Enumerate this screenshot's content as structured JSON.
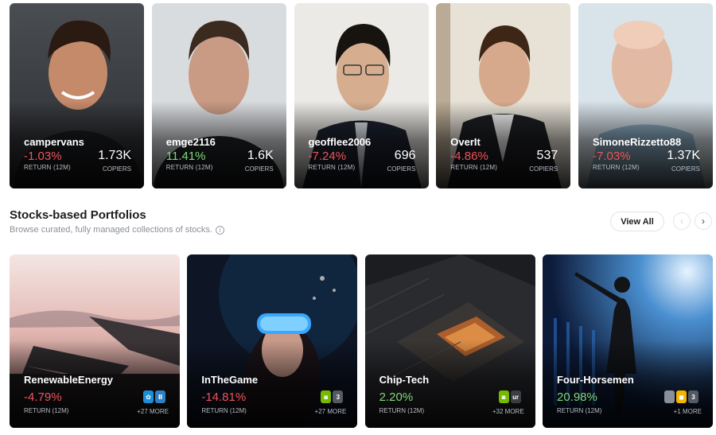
{
  "traders": [
    {
      "username": "campervans",
      "return": "-1.03%",
      "return_label": "RETURN (12M)",
      "copiers": "1.73K",
      "copiers_label": "COPIERS",
      "sentiment": "negative"
    },
    {
      "username": "emge2116",
      "return": "11.41%",
      "return_label": "RETURN (12M)",
      "copiers": "1.6K",
      "copiers_label": "COPIERS",
      "sentiment": "positive"
    },
    {
      "username": "geofflee2006",
      "return": "-7.24%",
      "return_label": "RETURN (12M)",
      "copiers": "696",
      "copiers_label": "COPIERS",
      "sentiment": "negative"
    },
    {
      "username": "OverIt",
      "return": "-4.86%",
      "return_label": "RETURN (12M)",
      "copiers": "537",
      "copiers_label": "COPIERS",
      "sentiment": "negative"
    },
    {
      "username": "SimoneRizzetto88",
      "return": "-7.03%",
      "return_label": "RETURN (12M)",
      "copiers": "1.37K",
      "copiers_label": "COPIERS",
      "sentiment": "negative"
    }
  ],
  "section": {
    "title": "Stocks-based Portfolios",
    "subtitle": "Browse curated, fully managed collections of stocks.",
    "info_icon": "i",
    "view_all": "View All",
    "prev_icon": "‹",
    "next_icon": "›"
  },
  "portfolios": [
    {
      "name": "RenewableEnergy",
      "return": "-4.79%",
      "return_label": "RETURN (12M)",
      "more": "+27 MORE",
      "logos": [
        "✿",
        "Ⅱ"
      ],
      "logo_colors": [
        "#1a8fd6",
        "#2f7fc4"
      ]
    },
    {
      "name": "InTheGame",
      "return": "-14.81%",
      "return_label": "RETURN (12M)",
      "more": "+27 MORE",
      "logos": [
        "◙",
        "3"
      ],
      "logo_colors": [
        "#76b900",
        "#555a62"
      ]
    },
    {
      "name": "Chip-Tech",
      "return": "2.20%",
      "return_label": "RETURN (12M)",
      "more": "+32 MORE",
      "logos": [
        "◙",
        "ur"
      ],
      "logo_colors": [
        "#76b900",
        "#3a3d42"
      ]
    },
    {
      "name": "Four-Horsemen",
      "return": "20.98%",
      "return_label": "RETURN (12M)",
      "more": "+1 MORE",
      "logos": [
        "",
        "◼",
        "3"
      ],
      "logo_colors": [
        "#8a8f99",
        "#f4b400",
        "#555a62"
      ]
    }
  ],
  "colors": {
    "negative": "#f0535a",
    "positive": "#7fd97a",
    "accent": "#1d1d1f"
  }
}
